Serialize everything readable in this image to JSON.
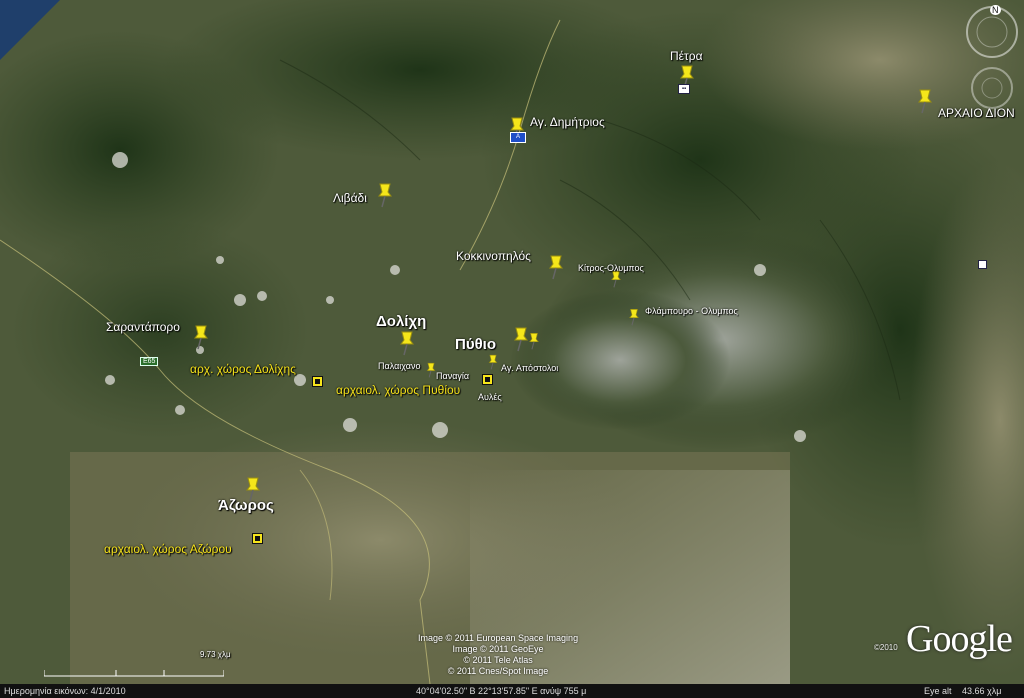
{
  "map": {
    "places": [
      {
        "name": "Πέτρα",
        "style": "med"
      },
      {
        "name": "ΑΡΧΑΙΟ ΔΙΟΝ",
        "style": "med"
      },
      {
        "name": "Αγ. Δημήτριος",
        "style": "med"
      },
      {
        "name": "Λιβάδι",
        "style": "med"
      },
      {
        "name": "Κοκκινοπηλός",
        "style": "med"
      },
      {
        "name": "Κίτρος-Ολυμπος",
        "style": "sm"
      },
      {
        "name": "Φλάμπουρο - Ολυμπος",
        "style": "sm"
      },
      {
        "name": "Σαραντάπορο",
        "style": "med"
      },
      {
        "name": "Δολίχη",
        "style": "big"
      },
      {
        "name": "Πύθιο",
        "style": "big"
      },
      {
        "name": "Αγ. Απόστολοι",
        "style": "sm"
      },
      {
        "name": "Παλαιχανο",
        "style": "sm"
      },
      {
        "name": "Παναγία",
        "style": "sm"
      },
      {
        "name": "Αυλές",
        "style": "sm"
      },
      {
        "name": "Άζωρος",
        "style": "big"
      }
    ],
    "sites": [
      {
        "name": "αρχ. χώρος Δολίχης"
      },
      {
        "name": "αρχαιολ. χώρος Πυθίου"
      },
      {
        "name": "αρχαιολ. χώρος Αζώρου"
      }
    ],
    "road_label": "E65",
    "scale_label": "9.73 χλμ",
    "credits": [
      "Image © 2011 European Space Imaging",
      "Image © 2011 GeoEye",
      "© 2011 Tele Atlas",
      "© 2011 Cnes/Spot Image"
    ],
    "brand": "Google",
    "brand_year": "©2010",
    "compass_letter": "N"
  },
  "status": {
    "image_date": "Ημερομηνία εικόνων: 4/1/2010",
    "coords": "40°04'02.50\" Β   22°13'57.85\" Ε  ανύψ  755 μ",
    "eye_alt_label": "Eye alt",
    "eye_alt_value": "43.66 χλμ"
  },
  "colors": {
    "pin": "#f5e61a",
    "site_label": "#f3e01a",
    "water": "#1f3f6b"
  }
}
